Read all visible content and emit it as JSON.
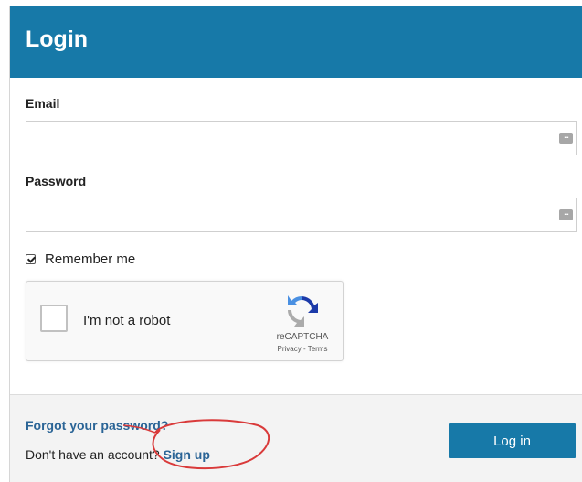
{
  "header": {
    "title": "Login"
  },
  "email": {
    "label": "Email",
    "value": "",
    "placeholder": ""
  },
  "password": {
    "label": "Password",
    "value": "",
    "placeholder": ""
  },
  "remember": {
    "label": "Remember me",
    "checked": true
  },
  "recaptcha": {
    "checkbox_label": "I'm not a robot",
    "brand": "reCAPTCHA",
    "links": "Privacy - Terms"
  },
  "footer": {
    "forgot_label": "Forgot your password?",
    "no_account_text": "Don't have an account?",
    "signup_label": "Sign up",
    "login_label": "Log in"
  },
  "colors": {
    "header_bg": "#1779a8",
    "link": "#2a6496",
    "button_bg": "#1779a8",
    "annotation": "#d93a3a"
  },
  "icons": {
    "field_autofill": "dots-icon",
    "recaptcha_logo": "recaptcha-logo-icon"
  }
}
